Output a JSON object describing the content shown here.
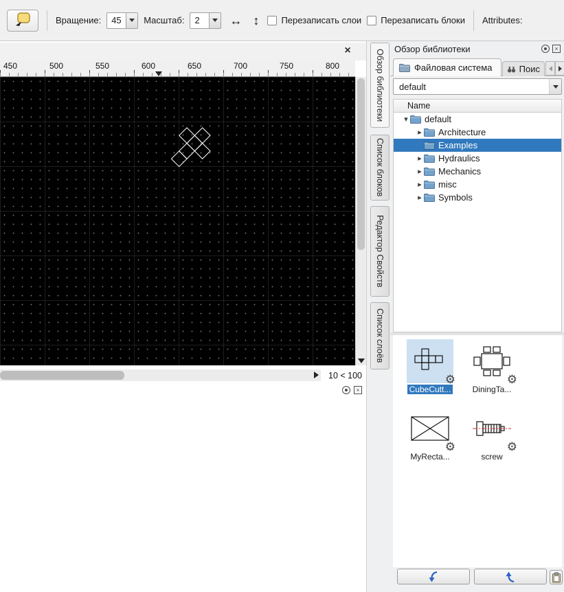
{
  "toolbar": {
    "rotation_label": "Вращение:",
    "rotation_value": "45",
    "scale_label": "Масштаб:",
    "scale_value": "2",
    "flip_horizontal_icon": "↔",
    "flip_vertical_icon": "↕",
    "overwrite_layers_label": "Перезаписать слои",
    "overwrite_blocks_label": "Перезаписать блоки",
    "attributes_label": "Attributes:"
  },
  "drawing": {
    "ruler_numbers": [
      "450",
      "500",
      "550",
      "600",
      "650",
      "700",
      "750",
      "800"
    ],
    "zoom_status": "10 < 100",
    "close_icon": "×"
  },
  "dock_tabs": {
    "library": "Обзор библиотеки",
    "blocks": "Список блоков",
    "properties": "Редактор Свойств",
    "layers": "Список слоёв"
  },
  "library": {
    "title": "Обзор библиотеки",
    "file_system_tab": "Файловая система",
    "search_tab": "Поис",
    "path_value": "default",
    "tree_header": "Name",
    "tree_root": "default",
    "tree_children": [
      "Architecture",
      "Examples",
      "Hydraulics",
      "Mechanics",
      "misc",
      "Symbols"
    ],
    "selected_folder": "Examples",
    "items": [
      "CubeCutt...",
      "DiningTa...",
      "MyRecta...",
      "screw"
    ],
    "selected_item": "CubeCutt..."
  },
  "icons": {
    "gear": "⚙",
    "branch_expanded": "▾",
    "branch_collapsed": "▸",
    "close_small": "×"
  },
  "colors": {
    "selection": "#3179be",
    "canvas_background": "#000000"
  }
}
